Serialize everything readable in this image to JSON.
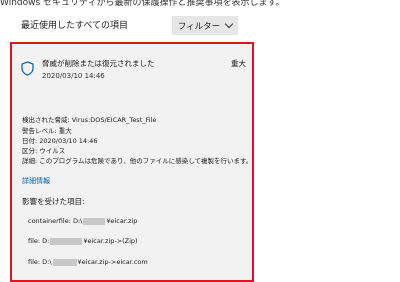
{
  "header": {
    "top_text": "Windows セキュリティから最新の保護操作と推奨事項を表示します。",
    "recent_label": "最近使用したすべての項目",
    "filter_label": "フィルター"
  },
  "card": {
    "title": "脅威が削除または復元されました",
    "date": "2020/03/10 14:46",
    "severity": "重大",
    "details": [
      "検出された脅威: Virus:DOS/EICAR_Test_File",
      "警告レベル: 重大",
      "日付: 2020/03/10 14:46",
      "区分: ウイルス",
      "詳細: このプログラムは危険であり、他のファイルに感染して複製を行います。"
    ],
    "details_link": "詳細情報",
    "affected_heading": "影響を受けた項目:",
    "files": [
      {
        "prefix": "containerfile: D:\\",
        "suffix": "¥eicar.zip"
      },
      {
        "prefix": "file: D:",
        "suffix": "¥eicar.zip->(Zip)"
      },
      {
        "prefix": "file: D:\\",
        "suffix": "¥eicar.zip->eicar.com"
      }
    ]
  },
  "colors": {
    "highlight_border": "#e0141e",
    "link": "#0063b1",
    "card_bg": "#f2f2f2"
  }
}
